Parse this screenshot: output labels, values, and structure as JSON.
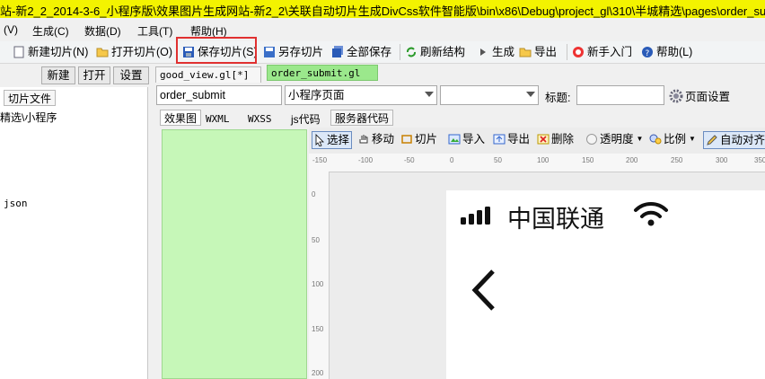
{
  "window": {
    "title": "站-新2_2_2014-3-6_小程序版\\效果图片生成网站-新2_2\\关联自动切片生成DivCss软件智能版\\bin\\x86\\Debug\\project_gl\\310\\半城精选\\pages\\order_submit."
  },
  "menu": [
    "(V)",
    "生成(C)",
    "数据(D)",
    "工具(T)",
    "帮助(H)"
  ],
  "toolbar": {
    "new_slice": "新建切片(N)",
    "open_slice": "打开切片(O)",
    "save_slice": "保存切片(S)",
    "save_as": "另存切片",
    "save_all": "全部保存",
    "refresh": "刷新结构",
    "generate": "生成",
    "export": "导出",
    "tutorial": "新手入门",
    "help": "帮助(L)"
  },
  "left": {
    "btn_new": "新建",
    "btn_open": "打开",
    "btn_settings": "设置",
    "tab_slices": "切片文件",
    "tree_item1": "精选\\小程序",
    "tree_item2": "json"
  },
  "doc_tabs": [
    "good_view.gl[*]",
    "order_submit.gl"
  ],
  "page_bar": {
    "name_value": "order_submit",
    "type_value": "小程序页面",
    "title_label": "标题:",
    "title_value": "",
    "page_settings": "页面设置"
  },
  "view_tabs": [
    "效果图",
    "WXML",
    "WXSS",
    "js代码",
    "服务器代码"
  ],
  "edit_toolbar": {
    "select": "选择",
    "move": "移动",
    "slice": "切片",
    "import": "导入",
    "export": "导出",
    "delete": "删除",
    "opacity": "透明度",
    "scale": "比例",
    "auto_align": "自动对齐"
  },
  "ruler_top": [
    "-150",
    "-100",
    "-50",
    "0",
    "50",
    "100",
    "150",
    "200",
    "250",
    "300",
    "350"
  ],
  "ruler_left": [
    "0",
    "50",
    "100",
    "150",
    "200"
  ],
  "phone": {
    "carrier": "中国联通"
  },
  "colors": {
    "title_bg": "#f3f300",
    "highlight": "#e03030",
    "green_panel": "#c6f7b8",
    "active_tab": "#9be88c"
  }
}
